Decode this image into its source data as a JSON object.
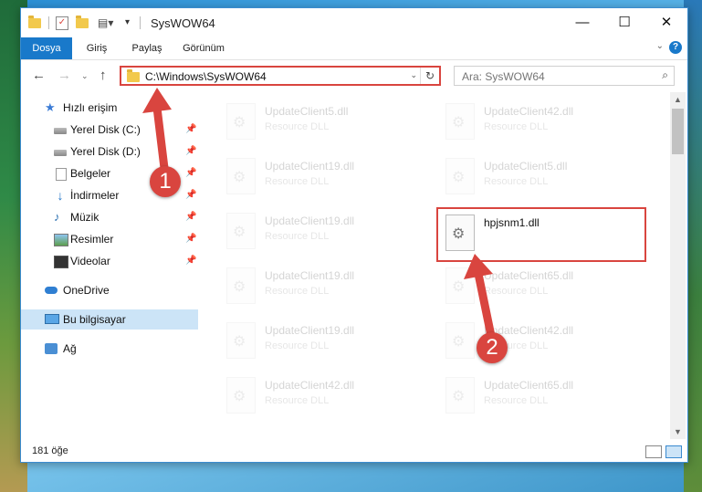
{
  "window": {
    "title": "SysWOW64"
  },
  "ribbon": {
    "tabs": [
      {
        "label": "Dosya",
        "active": true
      },
      {
        "label": "Giriş"
      },
      {
        "label": "Paylaş"
      },
      {
        "label": "Görünüm"
      }
    ]
  },
  "address": {
    "path": "C:\\Windows\\SysWOW64"
  },
  "search": {
    "placeholder": "Ara: SysWOW64"
  },
  "sidebar": {
    "items": [
      {
        "label": "Hızlı erişim"
      },
      {
        "label": "Yerel Disk (C:)"
      },
      {
        "label": "Yerel Disk (D:)"
      },
      {
        "label": "Belgeler"
      },
      {
        "label": "İndirmeler"
      },
      {
        "label": "Müzik"
      },
      {
        "label": "Resimler"
      },
      {
        "label": "Videolar"
      },
      {
        "label": "OneDrive"
      },
      {
        "label": "Bu bilgisayar"
      },
      {
        "label": "Ağ"
      }
    ]
  },
  "files": [
    {
      "name": "UpdateClient5.dll",
      "type": "Resource DLL"
    },
    {
      "name": "UpdateClient42.dll",
      "type": "Resource DLL"
    },
    {
      "name": "UpdateClient19.dll",
      "type": "Resource DLL"
    },
    {
      "name": "UpdateClient5.dll",
      "type": "Resource DLL"
    },
    {
      "name": "UpdateClient19.dll",
      "type": "Resource DLL"
    },
    {
      "name": "hpjsnm1.dll",
      "type": ""
    },
    {
      "name": "UpdateClient19.dll",
      "type": "Resource DLL"
    },
    {
      "name": "UpdateClient65.dll",
      "type": "Resource DLL"
    },
    {
      "name": "UpdateClient19.dll",
      "type": "Resource DLL"
    },
    {
      "name": "UpdateClient42.dll",
      "type": "Resource DLL"
    },
    {
      "name": "UpdateClient42.dll",
      "type": "Resource DLL"
    },
    {
      "name": "UpdateClient65.dll",
      "type": "Resource DLL"
    }
  ],
  "status": {
    "count": "181 öğe"
  },
  "annotations": {
    "step1": "1",
    "step2": "2",
    "color": "#d9453f"
  }
}
